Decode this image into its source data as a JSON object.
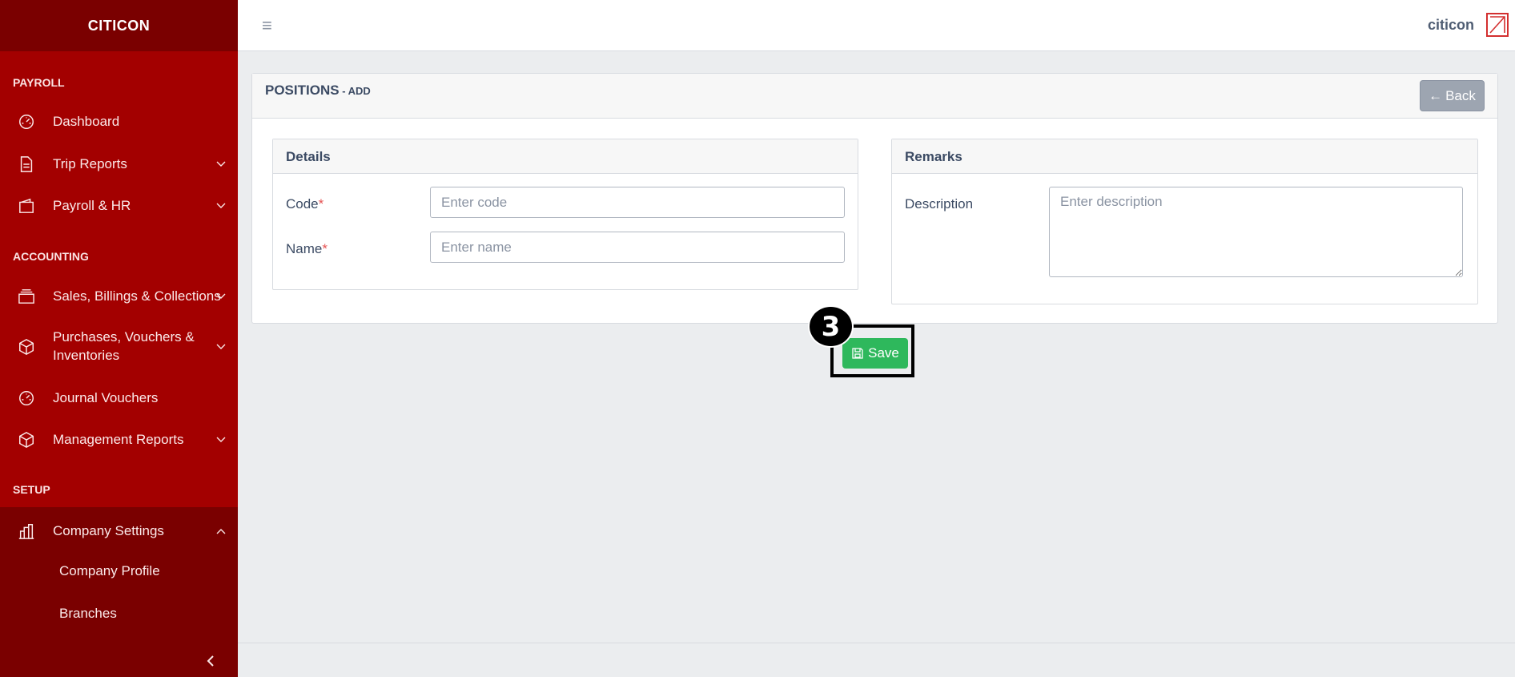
{
  "sidebar": {
    "brand": "CITICON",
    "sections": {
      "payroll": "PAYROLL",
      "accounting": "ACCOUNTING",
      "setup": "SETUP"
    },
    "items": {
      "dashboard": "Dashboard",
      "trip_reports": "Trip Reports",
      "payroll_hr": "Payroll & HR",
      "sales": "Sales, Billings & Collections",
      "purchases_line1": "Purchases, Vouchers &",
      "purchases_line2": "Inventories",
      "journal": "Journal Vouchers",
      "management": "Management Reports",
      "company_settings": "Company Settings",
      "company_profile": "Company Profile",
      "branches": "Branches"
    }
  },
  "header": {
    "username": "citicon"
  },
  "card": {
    "title": "POSITIONS",
    "subtitle": " - ADD",
    "back_label": "Back"
  },
  "details": {
    "heading": "Details",
    "code_label": "Code",
    "code_placeholder": "Enter code",
    "name_label": "Name",
    "name_placeholder": "Enter name",
    "required_mark": "*"
  },
  "remarks": {
    "heading": "Remarks",
    "description_label": "Description",
    "description_placeholder": "Enter description"
  },
  "actions": {
    "save_label": "Save",
    "annotation_number": "3"
  },
  "colors": {
    "sidebar": "#a30000",
    "sidebar_dark": "#7a0000",
    "save": "#2eb85c",
    "back": "#9da5b1"
  }
}
